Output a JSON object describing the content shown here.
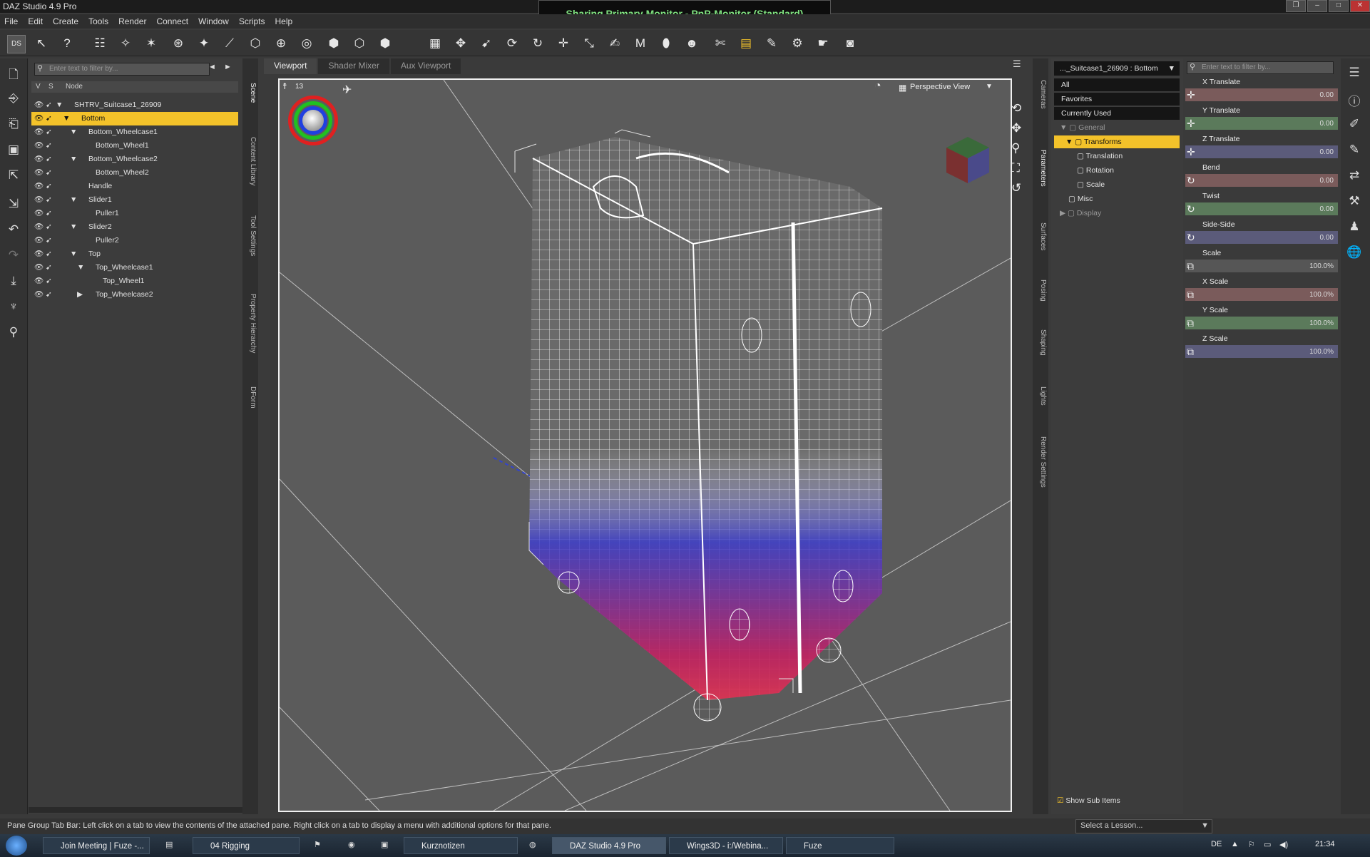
{
  "window": {
    "title": "DAZ Studio 4.9 Pro",
    "banner": "Sharing Primary Monitor - PnP-Monitor (Standard)"
  },
  "menu": [
    "File",
    "Edit",
    "Create",
    "Tools",
    "Render",
    "Connect",
    "Window",
    "Scripts",
    "Help"
  ],
  "scene": {
    "filter_placeholder": "Enter text to filter by...",
    "col_v": "V",
    "col_s": "S",
    "col_node": "Node",
    "nodes": [
      {
        "label": "SHTRV_Suitcase1_26909"
      },
      {
        "label": "Bottom"
      },
      {
        "label": "Bottom_Wheelcase1"
      },
      {
        "label": "Bottom_Wheel1"
      },
      {
        "label": "Bottom_Wheelcase2"
      },
      {
        "label": "Bottom_Wheel2"
      },
      {
        "label": "Handle"
      },
      {
        "label": "Slider1"
      },
      {
        "label": "Puller1"
      },
      {
        "label": "Slider2"
      },
      {
        "label": "Puller2"
      },
      {
        "label": "Top"
      },
      {
        "label": "Top_Wheelcase1"
      },
      {
        "label": "Top_Wheel1"
      },
      {
        "label": "Top_Wheelcase2"
      }
    ]
  },
  "left_side_tabs": [
    "Scene",
    "Content Library",
    "Tool Settings",
    "Property Hierarchy",
    "DForm"
  ],
  "viewport_tabs": [
    "Viewport",
    "Shader Mixer",
    "Aux Viewport"
  ],
  "viewport": {
    "view_name": "Perspective View",
    "count": "13"
  },
  "right_side_tabs": [
    "Cameras",
    "Parameters",
    "Surfaces",
    "Posing",
    "Shaping",
    "Lights",
    "Render Settings"
  ],
  "params": {
    "selector": "..._Suitcase1_26909 : Bottom",
    "filter_placeholder": "Enter text to filter by...",
    "tree": [
      "All",
      "Favorites",
      "Currently Used",
      "General",
      "Transforms",
      "Translation",
      "Rotation",
      "Scale",
      "Misc",
      "Display"
    ],
    "show_sub_items": "Show Sub Items"
  },
  "sliders": [
    {
      "name": "X Translate",
      "value": "0.00"
    },
    {
      "name": "Y Translate",
      "value": "0.00"
    },
    {
      "name": "Z Translate",
      "value": "0.00"
    },
    {
      "name": "Bend",
      "value": "0.00"
    },
    {
      "name": "Twist",
      "value": "0.00"
    },
    {
      "name": "Side-Side",
      "value": "0.00"
    },
    {
      "name": "Scale",
      "value": "100.0%"
    },
    {
      "name": "X Scale",
      "value": "100.0%"
    },
    {
      "name": "Y Scale",
      "value": "100.0%"
    },
    {
      "name": "Z Scale",
      "value": "100.0%"
    }
  ],
  "lesson_placeholder": "Select a Lesson...",
  "status": "Pane Group Tab Bar: Left click on a tab to view the contents of the attached pane. Right click on a tab to display a menu with additional options for that pane.",
  "taskbar": {
    "tasks": [
      "Join Meeting | Fuze -...",
      "04 Rigging",
      "Kurznotizen",
      "DAZ Studio 4.9 Pro",
      "Wings3D - i:/Webina...",
      "Fuze"
    ],
    "lang": "DE",
    "clock": "21:34"
  },
  "colors": {
    "selection": "#f3c22a",
    "banner_text": "#7fe07f"
  }
}
